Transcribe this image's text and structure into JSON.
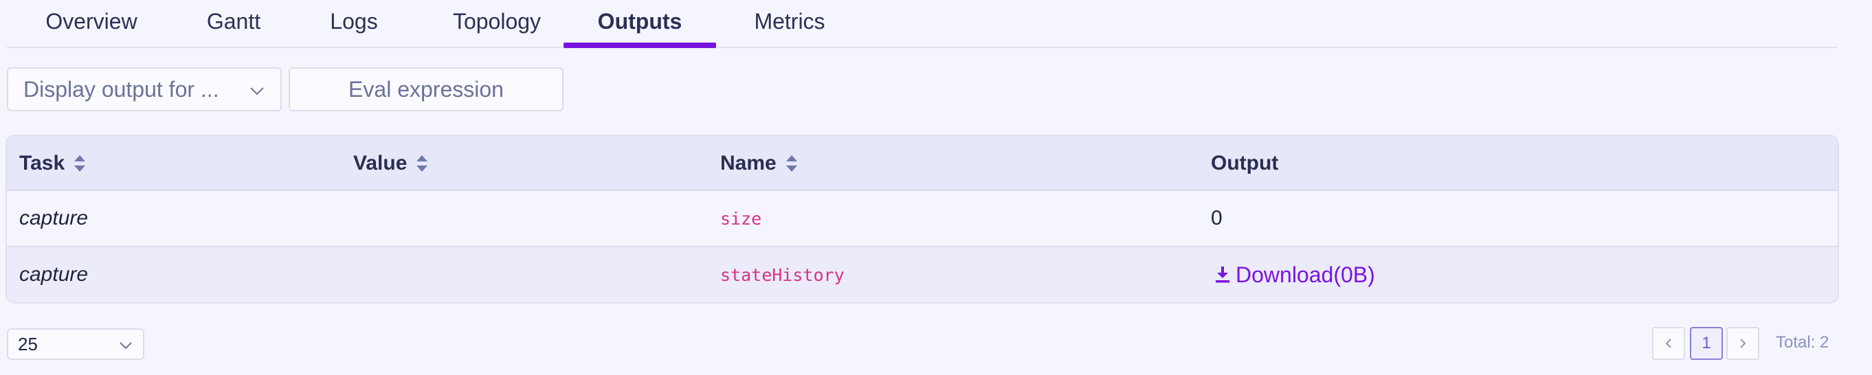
{
  "tabs": [
    {
      "label": "Overview",
      "active": false
    },
    {
      "label": "Gantt",
      "active": false
    },
    {
      "label": "Logs",
      "active": false
    },
    {
      "label": "Topology",
      "active": false
    },
    {
      "label": "Outputs",
      "active": true
    },
    {
      "label": "Metrics",
      "active": false
    }
  ],
  "toolbar": {
    "display_output_select": "Display output for ...",
    "eval_expression_label": "Eval expression"
  },
  "table": {
    "columns": [
      {
        "label": "Task",
        "sortable": true
      },
      {
        "label": "Value",
        "sortable": true
      },
      {
        "label": "Name",
        "sortable": true
      },
      {
        "label": "Output",
        "sortable": false
      }
    ],
    "rows": [
      {
        "task": "capture",
        "value": "",
        "name": "size",
        "output": "0",
        "output_is_download": false
      },
      {
        "task": "capture",
        "value": "",
        "name": "stateHistory",
        "output": "Download(0B)",
        "output_is_download": true
      }
    ]
  },
  "footer": {
    "page_size": "25",
    "current_page": "1",
    "total": "Total: 2"
  },
  "colors": {
    "accent": "#7a14e0",
    "code": "#d63384",
    "background": "#f5f5fd",
    "header_background": "#e7e7fa"
  },
  "icons": {
    "sort": "sort-icon",
    "download": "download-icon",
    "chevron_down": "chevron-down-icon",
    "prev": "chevron-left-icon",
    "next": "chevron-right-icon"
  }
}
